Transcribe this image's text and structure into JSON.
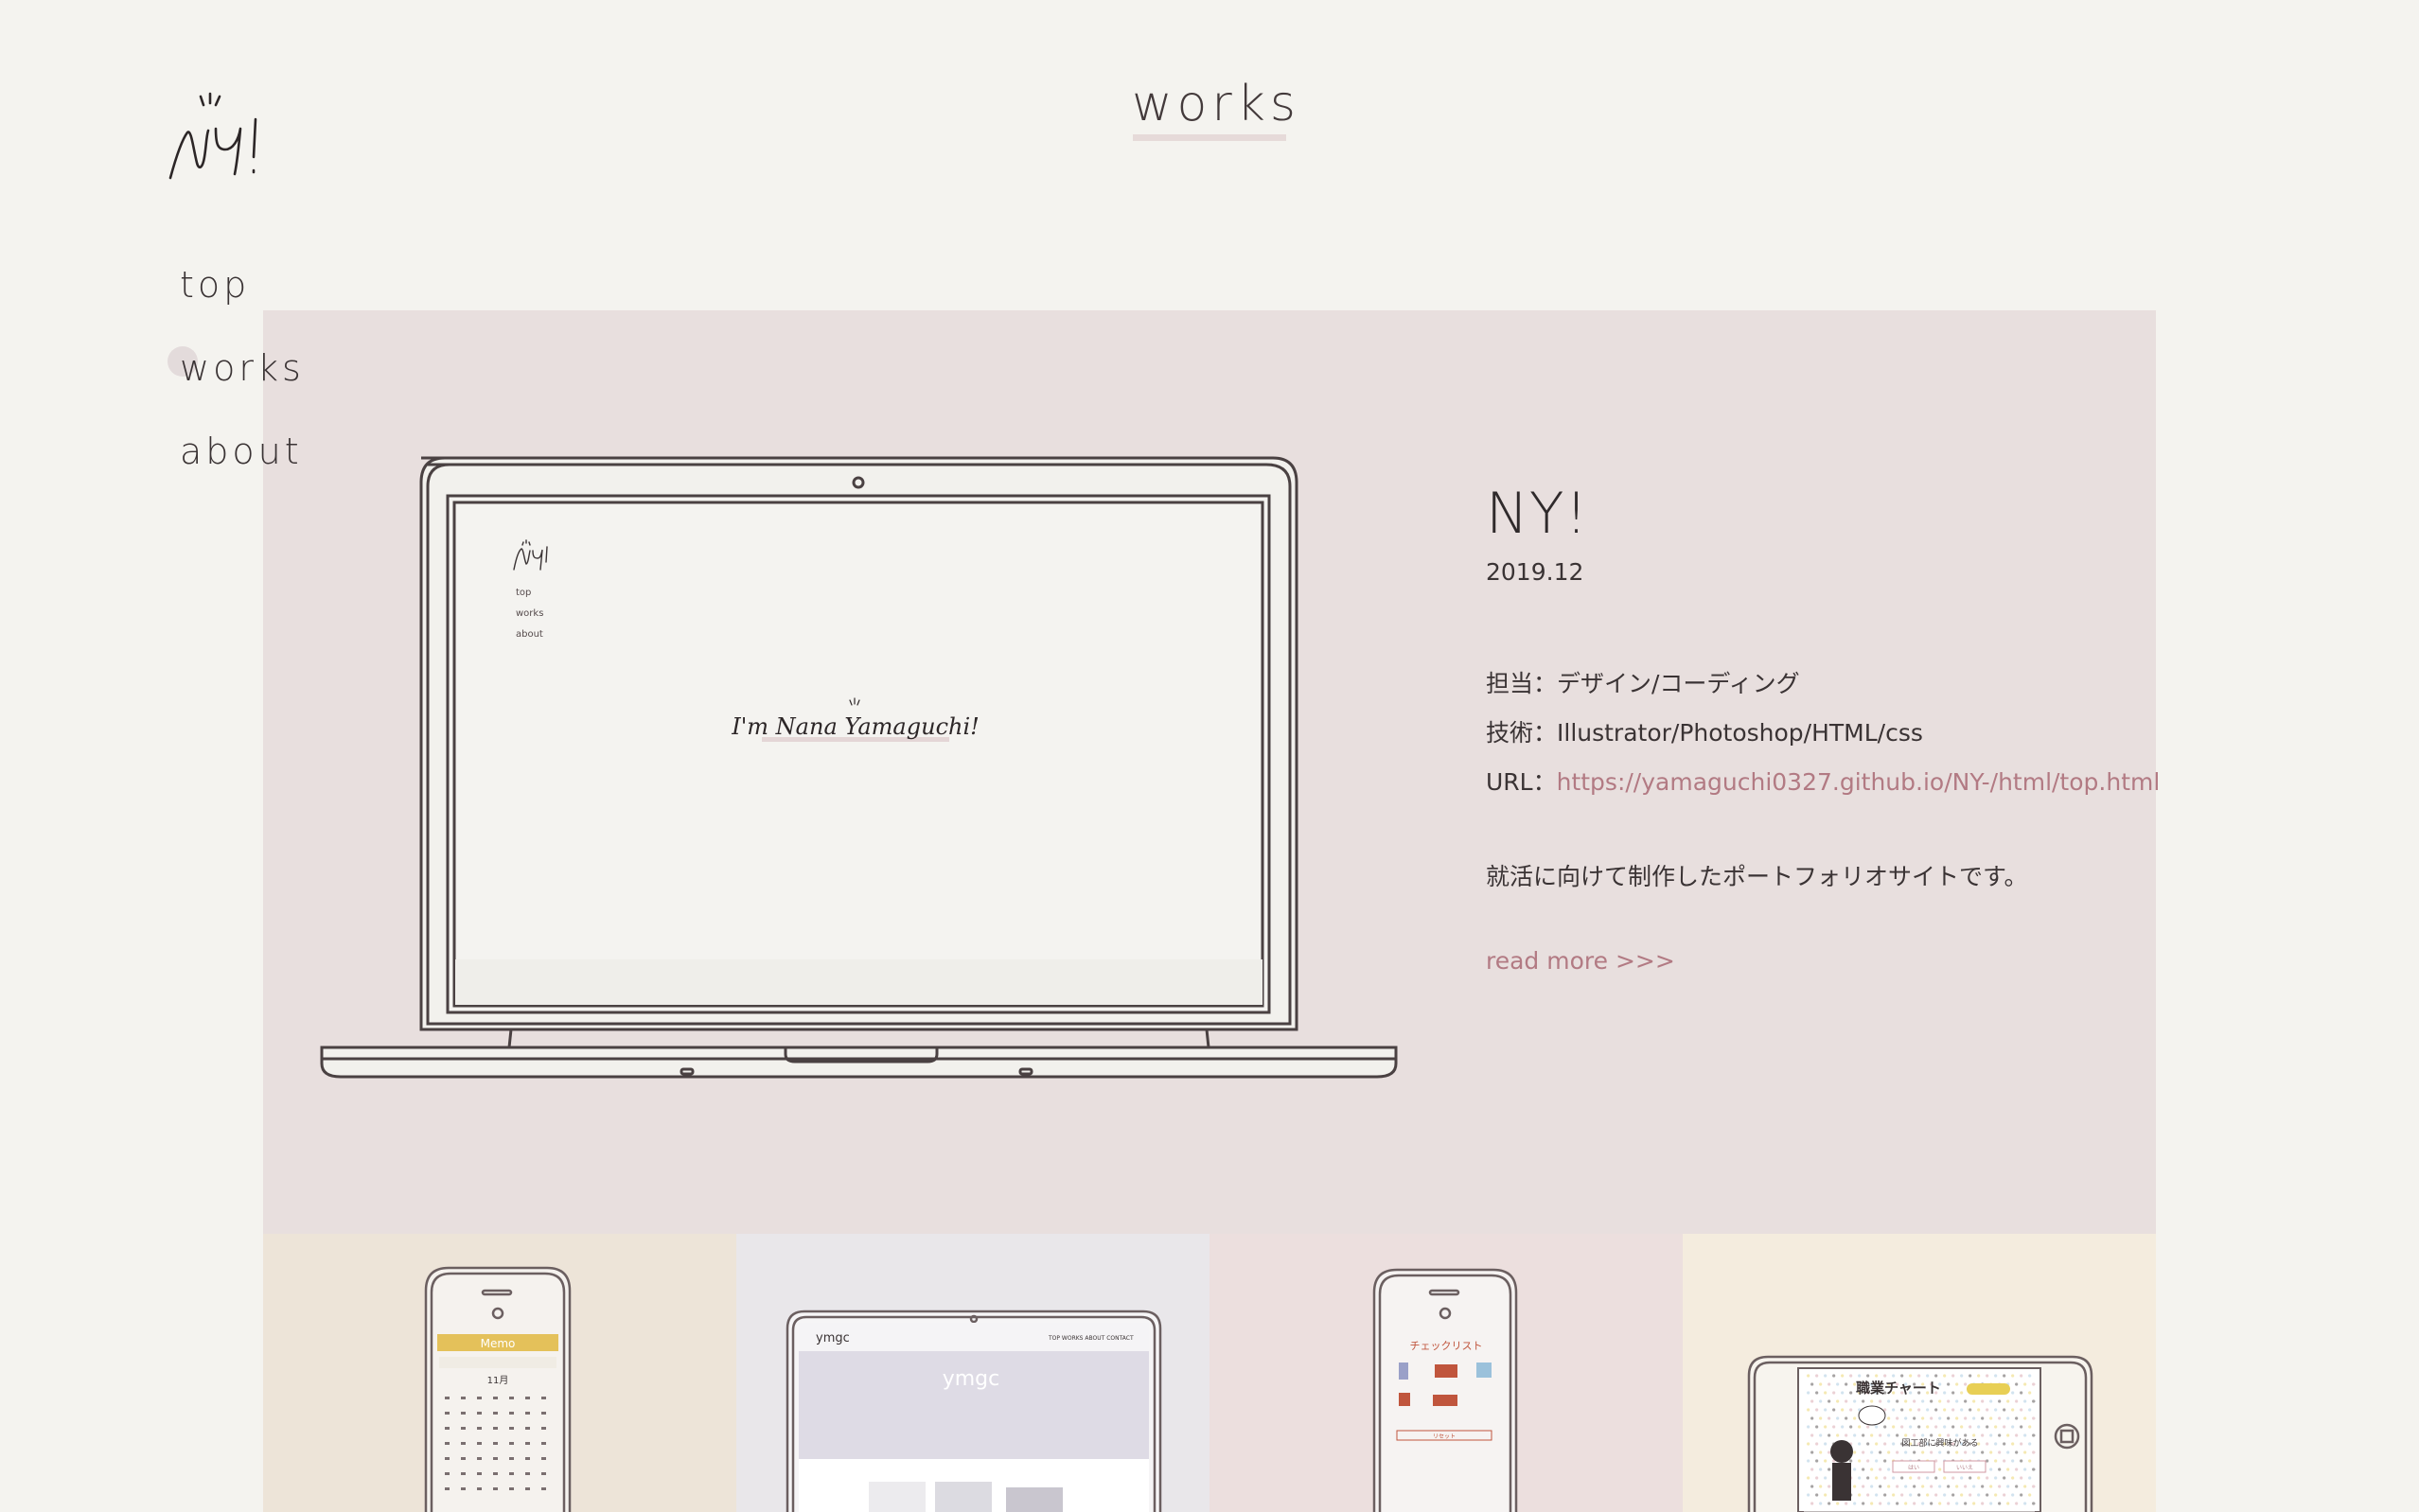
{
  "colors": {
    "page_bg": "#f4f3ef",
    "featured_bg": "#e8dfde",
    "accent_link": "#b27a83",
    "text": "#3a3334"
  },
  "logo": {
    "text": "NY!",
    "icon": "handwritten-logo"
  },
  "page_title": "works",
  "nav": {
    "items": [
      {
        "label": "top",
        "active": false
      },
      {
        "label": "works",
        "active": true
      },
      {
        "label": "about",
        "active": false
      }
    ]
  },
  "featured": {
    "title": "NY!",
    "date": "2019.12",
    "role": "担当：デザイン/コーディング",
    "tech": "技術：Illustrator/Photoshop/HTML/css",
    "url_label": "URL：",
    "url": "https://yamaguchi0327.github.io/NY-/html/top.html",
    "description": "就活に向けて制作したポートフォリオサイトです。",
    "read_more": "read more >>>",
    "screen": {
      "nav": [
        "top",
        "works",
        "about"
      ],
      "headline": "I'm Nana Yamaguchi!"
    }
  },
  "thumbnails": [
    {
      "name": "calendar-app",
      "bg": "#ede4d8",
      "device": "phone",
      "screen_title": "Memo",
      "month": "11月"
    },
    {
      "name": "ymgc-site",
      "bg": "#e9e7ea",
      "device": "laptop",
      "screen_title": "ymgc",
      "menu": [
        "TOP",
        "WORKS",
        "ABOUT",
        "CONTACT"
      ]
    },
    {
      "name": "checklist-app",
      "bg": "#ecdfde",
      "device": "phone",
      "screen_title": "チェックリスト",
      "button": "リセット"
    },
    {
      "name": "career-chart",
      "bg": "#f4ecde",
      "device": "phone-landscape",
      "screen_title": "職業チャート",
      "question": "図工部に興味がある",
      "options": [
        "はい",
        "いいえ"
      ]
    }
  ]
}
